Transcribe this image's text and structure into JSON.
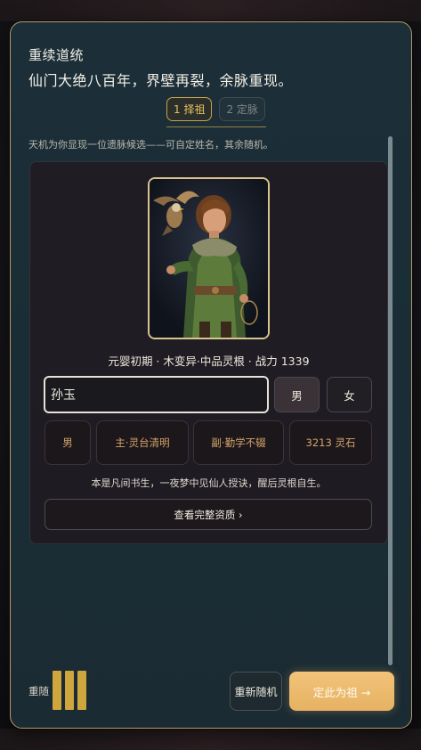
{
  "header": {
    "title": "重续道统",
    "subtitle": "仙门大绝八百年，界壁再裂，余脉重现。"
  },
  "steps": [
    {
      "label": "1 择祖",
      "active": true
    },
    {
      "label": "2 定脉",
      "active": false
    }
  ],
  "hint": "天机为你显现一位遗脉候选——可自定姓名，其余随机。",
  "candidate": {
    "summary": "元婴初期 · 木变异·中品灵根 · 战力 1339",
    "name_value": "孙玉",
    "gender_options": [
      "男",
      "女"
    ],
    "selected_gender": "男",
    "tags": [
      "男",
      "主·灵台清明",
      "副·勤学不辍",
      "3213 灵石"
    ],
    "bio": "本是凡间书生，一夜梦中见仙人授诀，醒后灵根自生。",
    "view_button": "查看完整资质 ›"
  },
  "footer": {
    "reroll_label": "重随",
    "reroll_count": 3,
    "reroll_button": "重新随机",
    "confirm_button": "定此为祖 →"
  },
  "colors": {
    "accent_gold": "#c9a347",
    "confirm_bg": "#f2c379",
    "panel_bg": "#1c2f38",
    "tag_text": "#d6a36a"
  },
  "icons": {
    "portrait": "cultivator-with-falcon-portrait"
  }
}
